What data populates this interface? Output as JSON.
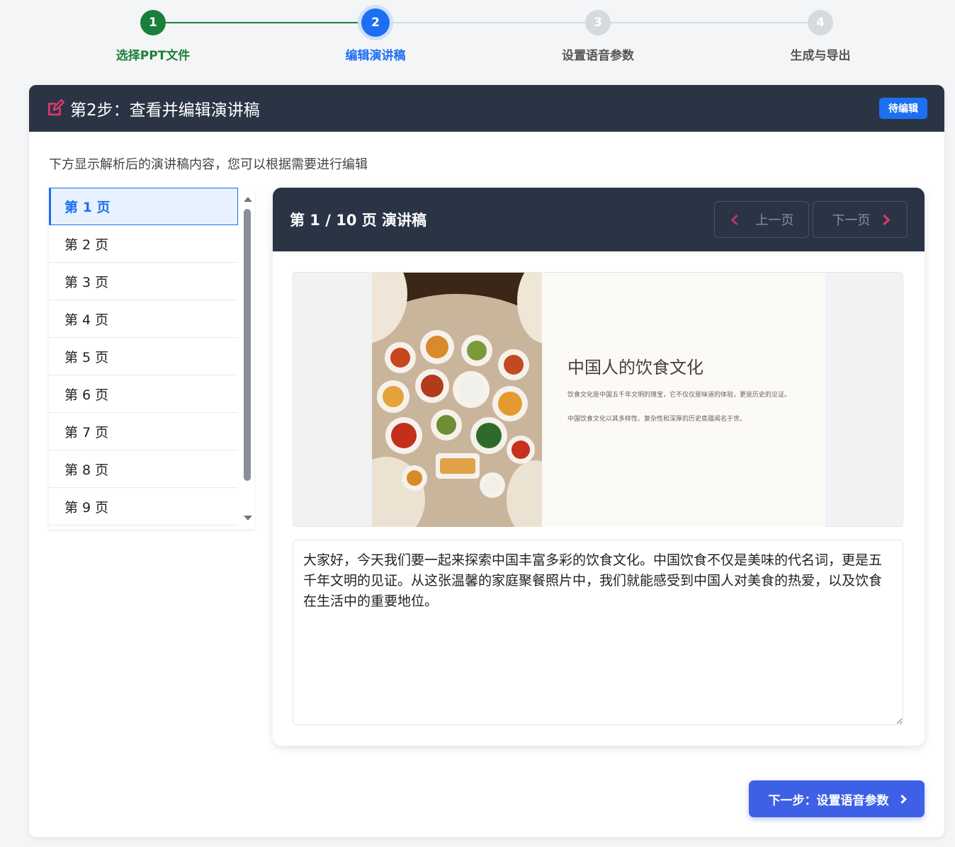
{
  "stepper": {
    "steps": [
      {
        "number": "1",
        "label": "选择PPT文件",
        "state": "done"
      },
      {
        "number": "2",
        "label": "编辑演讲稿",
        "state": "active"
      },
      {
        "number": "3",
        "label": "设置语音参数",
        "state": "todo"
      },
      {
        "number": "4",
        "label": "生成与导出",
        "state": "todo"
      }
    ]
  },
  "card": {
    "title": "第2步：查看并编辑演讲稿",
    "status_badge": "待编辑",
    "description": "下方显示解析后的演讲稿内容，您可以根据需要进行编辑"
  },
  "page_list": {
    "items": [
      "第 1 页",
      "第 2 页",
      "第 3 页",
      "第 4 页",
      "第 5 页",
      "第 6 页",
      "第 7 页",
      "第 8 页",
      "第 9 页"
    ],
    "selected_index": 0
  },
  "script_panel": {
    "title": "第 1 / 10 页 演讲稿",
    "prev_label": "上一页",
    "next_label": "下一页",
    "slide": {
      "title": "中国人的饮食文化",
      "paragraph_1": "饮食文化是中国五千年文明的瑰宝，它不仅仅是味道的体验，更是历史的见证。",
      "paragraph_2": "中国饮食文化以其多样性、复杂性和深厚的历史底蕴闻名于世。"
    },
    "script_text": "大家好，今天我们要一起来探索中国丰富多彩的饮食文化。中国饮食不仅是美味的代名词，更是五千年文明的见证。从这张温馨的家庭聚餐照片中，我们就能感受到中国人对美食的热爱，以及饮食在生活中的重要地位。"
  },
  "footer": {
    "next_step_label": "下一步：设置语音参数"
  },
  "colors": {
    "done_green": "#1a7f3b",
    "active_blue": "#1d6ff2",
    "header_dark": "#2b3445",
    "chevron_pink": "#e3386b",
    "primary_button": "#3e60e6"
  }
}
